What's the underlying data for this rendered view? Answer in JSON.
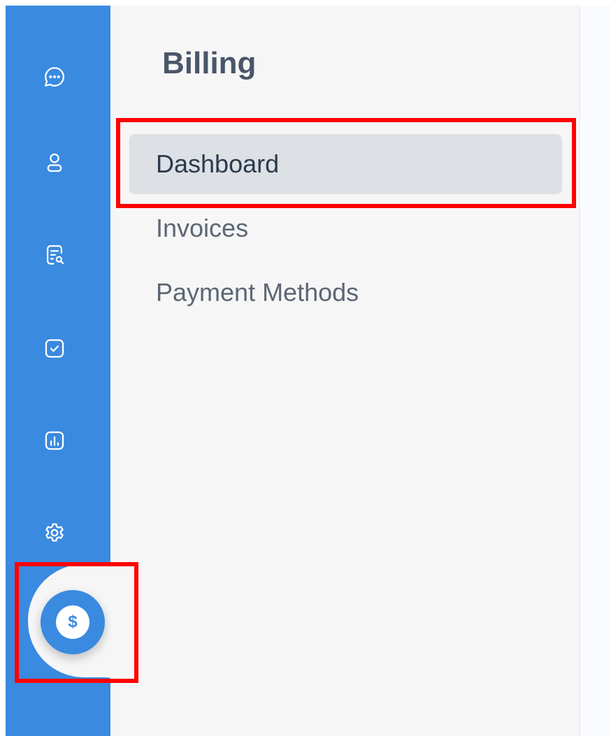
{
  "colors": {
    "rail": "#3a8ae0",
    "panel": "#f6f6f6",
    "active_item": "#dde0e4",
    "highlight": "#ff0000"
  },
  "rail": {
    "items": [
      {
        "name": "chat-icon"
      },
      {
        "name": "user-icon"
      },
      {
        "name": "document-search-icon"
      },
      {
        "name": "checkbox-icon"
      },
      {
        "name": "chart-icon"
      },
      {
        "name": "gear-icon"
      }
    ],
    "active": {
      "name": "dollar-icon",
      "glyph": "$"
    }
  },
  "panel": {
    "title": "Billing",
    "items": [
      {
        "label": "Dashboard",
        "active": true
      },
      {
        "label": "Invoices",
        "active": false
      },
      {
        "label": "Payment Methods",
        "active": false
      }
    ]
  }
}
